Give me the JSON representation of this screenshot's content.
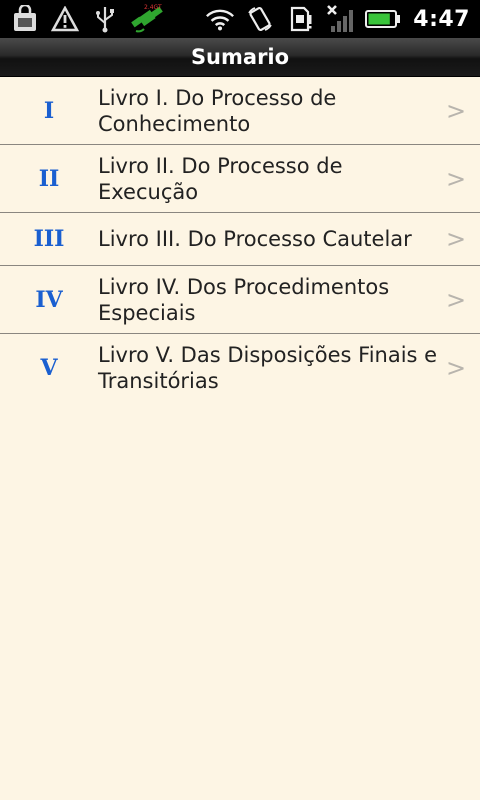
{
  "status_bar": {
    "icons_left": [
      "shopping-bag-icon",
      "warning-icon",
      "usb-icon",
      "gps-satellite-icon"
    ],
    "icons_right": [
      "wifi-icon",
      "rotate-icon",
      "sd-card-icon",
      "no-signal-icon",
      "battery-icon"
    ],
    "time": "4:47",
    "battery_level": 0.85,
    "colors": {
      "battery": "#39c43a",
      "gps": "#2fa52f"
    }
  },
  "header": {
    "title": "Sumario"
  },
  "books": [
    {
      "numeral": "I",
      "title": "Livro I. Do Processo de Conhecimento"
    },
    {
      "numeral": "II",
      "title": "Livro II. Do Processo de Execução"
    },
    {
      "numeral": "III",
      "title": "Livro III. Do Processo Cautelar"
    },
    {
      "numeral": "IV",
      "title": "Livro IV. Dos Procedimentos Especiais"
    },
    {
      "numeral": "V",
      "title": "Livro V. Das Disposições Finais e Transitórias"
    }
  ],
  "chevron": ">",
  "colors": {
    "background": "#fdf5e4",
    "numeral": "#1a5fd0",
    "divider": "#8a8680"
  }
}
